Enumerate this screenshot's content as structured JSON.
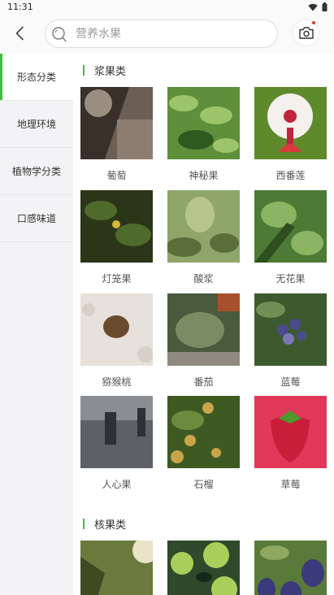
{
  "status_bar": {
    "time": "11:31"
  },
  "header": {
    "search_placeholder": "营养水果"
  },
  "sidebar": {
    "items": [
      {
        "label": "形态分类",
        "active": true
      },
      {
        "label": "地理环境",
        "active": false
      },
      {
        "label": "植物学分类",
        "active": false
      },
      {
        "label": "口感味道",
        "active": false
      }
    ]
  },
  "sections": [
    {
      "title": "浆果类",
      "items": [
        {
          "name": "葡萄",
          "colors": [
            "#6b5e55",
            "#b3a597",
            "#3a302a"
          ]
        },
        {
          "name": "神秘果",
          "colors": [
            "#5f8f3a",
            "#9cc46a",
            "#2f5a1f"
          ]
        },
        {
          "name": "西番莲",
          "colors": [
            "#5e8a2c",
            "#f4f0ee",
            "#c2233c"
          ]
        },
        {
          "name": "灯笼果",
          "colors": [
            "#2b3618",
            "#4f6a2a",
            "#d7b935"
          ]
        },
        {
          "name": "酸浆",
          "colors": [
            "#8fa56a",
            "#b8c58a",
            "#5a6e3a"
          ]
        },
        {
          "name": "无花果",
          "colors": [
            "#4d7a35",
            "#8bb463",
            "#2d4e1e"
          ]
        },
        {
          "name": "猕猴桃",
          "colors": [
            "#e7e1dc",
            "#d8cfc8",
            "#6b4b2e"
          ]
        },
        {
          "name": "番茄",
          "colors": [
            "#4a5a3c",
            "#7a8c63",
            "#a6512c"
          ]
        },
        {
          "name": "蓝莓",
          "colors": [
            "#3d5a2e",
            "#6f8f55",
            "#4b4a8a"
          ]
        },
        {
          "name": "人心果",
          "colors": [
            "#5d6066",
            "#8a8d92",
            "#2e3034"
          ]
        },
        {
          "name": "石榴",
          "colors": [
            "#3e5a22",
            "#6e8a3c",
            "#c9a44a"
          ]
        },
        {
          "name": "草莓",
          "colors": [
            "#e1385a",
            "#c81e3a",
            "#4c9a2a"
          ]
        }
      ]
    },
    {
      "title": "核果类",
      "items": [
        {
          "name": "",
          "colors": [
            "#6b7a3c",
            "#e9e3c8",
            "#3f4a22"
          ]
        },
        {
          "name": "",
          "colors": [
            "#2e4a2a",
            "#a9cf5a",
            "#16281a"
          ]
        },
        {
          "name": "",
          "colors": [
            "#5a7a3a",
            "#8fa860",
            "#3b3a7a"
          ]
        }
      ]
    }
  ]
}
